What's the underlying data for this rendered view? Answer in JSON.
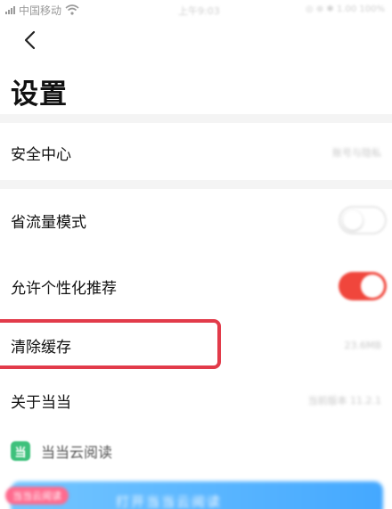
{
  "status_bar": {
    "carrier": "中国移动",
    "time": "上午9:03",
    "indicators": "◎ ⊕ ✱ 1.00 100%"
  },
  "nav": {
    "back_icon": "chevron-left-icon"
  },
  "page_title": "设置",
  "settings": {
    "security_center": {
      "label": "安全中心",
      "value": "账号与隐私"
    },
    "data_saver": {
      "label": "省流量模式",
      "state": "off"
    },
    "personalized_recommend": {
      "label": "允许个性化推荐",
      "state": "on"
    },
    "clear_cache": {
      "label": "清除缓存",
      "value": "23.6MB"
    },
    "about": {
      "label": "关于当当",
      "value": "当前版本 11.2.1"
    }
  },
  "brand": {
    "logo_glyph": "当",
    "name": "当当云阅读"
  },
  "banner": {
    "badge": "当当云阅读",
    "text": "打开当当云阅读"
  },
  "colors": {
    "accent_red": "#f0463c",
    "highlight_red": "#e23b4a",
    "brand_green": "#3ec17c",
    "banner_blue": "#44a8ff",
    "gap_gray": "#f4f4f4"
  }
}
